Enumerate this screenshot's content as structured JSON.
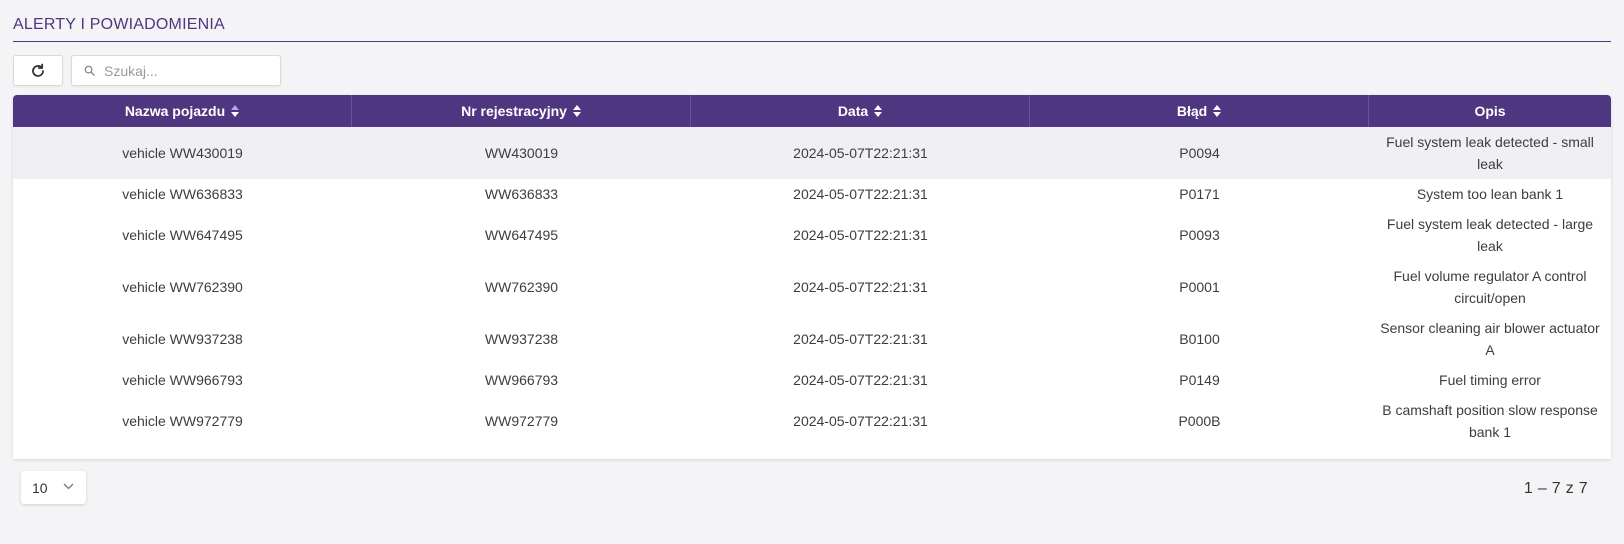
{
  "header": {
    "title": "ALERTY I POWIADOMIENIA"
  },
  "toolbar": {
    "search_placeholder": "Szukaj..."
  },
  "table": {
    "columns": [
      {
        "label": "Nazwa pojazdu",
        "sortable": true,
        "active": true
      },
      {
        "label": "Nr rejestracyjny",
        "sortable": true
      },
      {
        "label": "Data",
        "sortable": true
      },
      {
        "label": "Błąd",
        "sortable": true
      },
      {
        "label": "Opis",
        "sortable": false
      }
    ],
    "rows": [
      {
        "name": "vehicle WW430019",
        "reg": "WW430019",
        "date": "2024-05-07T22:21:31",
        "error": "P0094",
        "desc": "Fuel system leak detected - small leak"
      },
      {
        "name": "vehicle WW636833",
        "reg": "WW636833",
        "date": "2024-05-07T22:21:31",
        "error": "P0171",
        "desc": "System too lean bank 1"
      },
      {
        "name": "vehicle WW647495",
        "reg": "WW647495",
        "date": "2024-05-07T22:21:31",
        "error": "P0093",
        "desc": "Fuel system leak detected - large leak"
      },
      {
        "name": "vehicle WW762390",
        "reg": "WW762390",
        "date": "2024-05-07T22:21:31",
        "error": "P0001",
        "desc": "Fuel volume regulator A control circuit/open"
      },
      {
        "name": "vehicle WW937238",
        "reg": "WW937238",
        "date": "2024-05-07T22:21:31",
        "error": "B0100",
        "desc": "Sensor cleaning air blower actuator A"
      },
      {
        "name": "vehicle WW966793",
        "reg": "WW966793",
        "date": "2024-05-07T22:21:31",
        "error": "P0149",
        "desc": "Fuel timing error"
      },
      {
        "name": "vehicle WW972779",
        "reg": "WW972779",
        "date": "2024-05-07T22:21:31",
        "error": "P000B",
        "desc": "B camshaft position slow response bank 1"
      }
    ]
  },
  "pagination": {
    "per_page": "10",
    "range": "1 – 7 z 7"
  },
  "icons": {
    "refresh": "refresh-icon",
    "search": "search-icon",
    "sort": "sort-icon",
    "dropdown": "chevron-down-icon"
  },
  "colors": {
    "accent": "#4e3680",
    "row_highlight": "#f0f0f4"
  }
}
